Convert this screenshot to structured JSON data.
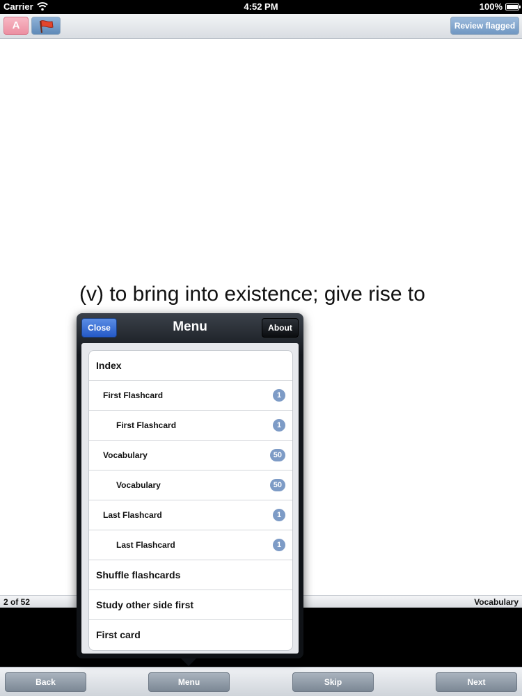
{
  "status_bar": {
    "carrier": "Carrier",
    "time": "4:52 PM",
    "battery": "100%"
  },
  "toolbar": {
    "font_label": "A",
    "review_label": "Review flagged"
  },
  "card": {
    "text": "(v) to bring into existence; give rise to"
  },
  "info_bar": {
    "counter": "2 of 52",
    "deck": "Vocabulary"
  },
  "menu": {
    "title": "Menu",
    "close_label": "Close",
    "about_label": "About",
    "items": [
      {
        "label": "Index",
        "count": null
      },
      {
        "label": "First Flashcard",
        "count": "1"
      },
      {
        "label": "First Flashcard",
        "count": "1"
      },
      {
        "label": "Vocabulary",
        "count": "50"
      },
      {
        "label": "Vocabulary",
        "count": "50"
      },
      {
        "label": "Last Flashcard",
        "count": "1"
      },
      {
        "label": "Last Flashcard",
        "count": "1"
      },
      {
        "label": "Shuffle flashcards",
        "count": null
      },
      {
        "label": "Study other side first",
        "count": null
      },
      {
        "label": "First card",
        "count": null
      }
    ]
  },
  "bottom_toolbar": {
    "back_label": "Back",
    "menu_label": "Menu",
    "skip_label": "Skip",
    "next_label": "Next"
  }
}
